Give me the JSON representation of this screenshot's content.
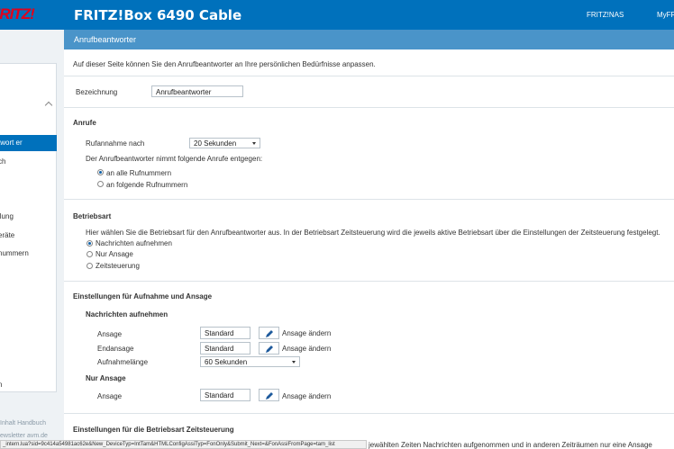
{
  "header": {
    "logo_text": "FRITZ!",
    "title": "FRITZ!Box 6490 Cable",
    "nav": [
      "FRITZ!NAS",
      "MyFR"
    ]
  },
  "subheader": {
    "title": "Anrufbeantworter"
  },
  "sidebar": {
    "items": [
      "twort er",
      "ch",
      "llung",
      "eräte",
      "nummern"
    ],
    "bottom": "n"
  },
  "footer": {
    "line1": "Inhalt   Handbuch",
    "line2": "ewsletter   avm.de"
  },
  "status_url": "_intern.lua?sid=9c414a54981ac62e&New_DeviceTyp=IntTam&HTMLConfigAssiTyp=FonOnly&Submit_Next=&FonAssiFromPage=tam_list",
  "main": {
    "intro": "Auf dieser Seite können Sie den Anrufbeantworter an Ihre persönlichen Bedürfnisse anpassen.",
    "bezeichnung_label": "Bezeichnung",
    "bezeichnung_value": "Anrufbeantworter",
    "anrufe_heading": "Anrufe",
    "rufannahme_label": "Rufannahme nach",
    "rufannahme_value": "20 Sekunden",
    "folgende_text": "Der Anrufbeantworter nimmt folgende Anrufe entgegen:",
    "rufnummern_options": [
      "an alle Rufnummern",
      "an folgende Rufnummern"
    ],
    "betriebsart_heading": "Betriebsart",
    "betriebsart_text": "Hier wählen Sie die Betriebsart für den Anrufbeantworter aus. In der Betriebsart Zeitsteuerung wird die jeweils aktive Betriebsart über die Einstellungen der Zeitsteuerung festgelegt.",
    "betriebsart_options": [
      "Nachrichten aufnehmen",
      "Nur Ansage",
      "Zeitsteuerung"
    ],
    "einstellungen_heading": "Einstellungen für Aufnahme und Ansage",
    "nachrichten_heading": "Nachrichten aufnehmen",
    "ansage_label": "Ansage",
    "ansage_value": "Standard",
    "ansage_aendern": "Ansage ändern",
    "endansage_label": "Endansage",
    "endansage_value": "Standard",
    "endansage_aendern": "Ansage ändern",
    "aufnahmelaenge_label": "Aufnahmelänge",
    "aufnahmelaenge_value": "60 Sekunden",
    "nur_ansage_heading": "Nur Ansage",
    "nur_ansage_label": "Ansage",
    "nur_ansage_value": "Standard",
    "nur_ansage_aendern": "Ansage ändern",
    "zeitsteuerung_heading": "Einstellungen für die Betriebsart Zeitsteuerung",
    "zeitsteuerung_text": "jewählten Zeiten Nachrichten aufgenommen und in anderen Zeiträumen nur eine Ansage"
  }
}
